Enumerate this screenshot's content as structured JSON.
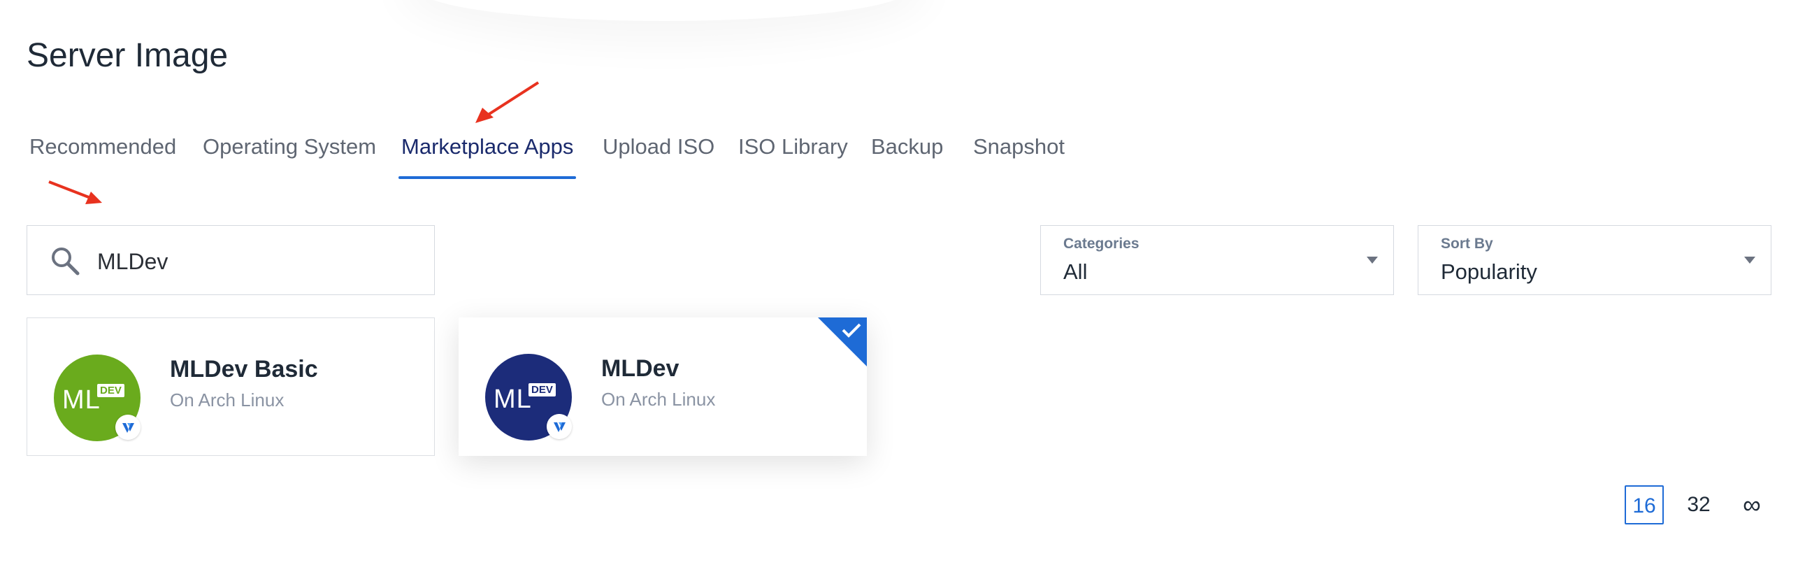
{
  "page": {
    "title": "Server Image"
  },
  "tabs": [
    {
      "label": "Recommended"
    },
    {
      "label": "Operating System"
    },
    {
      "label": "Marketplace Apps"
    },
    {
      "label": "Upload ISO"
    },
    {
      "label": "ISO Library"
    },
    {
      "label": "Backup"
    },
    {
      "label": "Snapshot"
    }
  ],
  "active_tab": "Marketplace Apps",
  "search": {
    "value": "MLDev"
  },
  "filters": {
    "categories": {
      "label": "Categories",
      "value": "All"
    },
    "sort": {
      "label": "Sort By",
      "value": "Popularity"
    }
  },
  "apps": [
    {
      "name": "MLDev Basic",
      "subtitle": "On Arch Linux",
      "logo_text": "ML",
      "logo_badge": "DEV",
      "logo_color": "#6aab1d",
      "selected": false
    },
    {
      "name": "MLDev",
      "subtitle": "On Arch Linux",
      "logo_text": "ML",
      "logo_badge": "DEV",
      "logo_color": "#1c2c7a",
      "selected": true
    }
  ],
  "pagination": {
    "options": [
      "16",
      "32",
      "∞"
    ],
    "active": "16"
  },
  "colors": {
    "accent": "#1e6bd6",
    "annotation_arrow": "#e8321f"
  },
  "icons": {
    "search": "search-icon",
    "check": "check-icon",
    "caret": "chevron-down-icon"
  }
}
